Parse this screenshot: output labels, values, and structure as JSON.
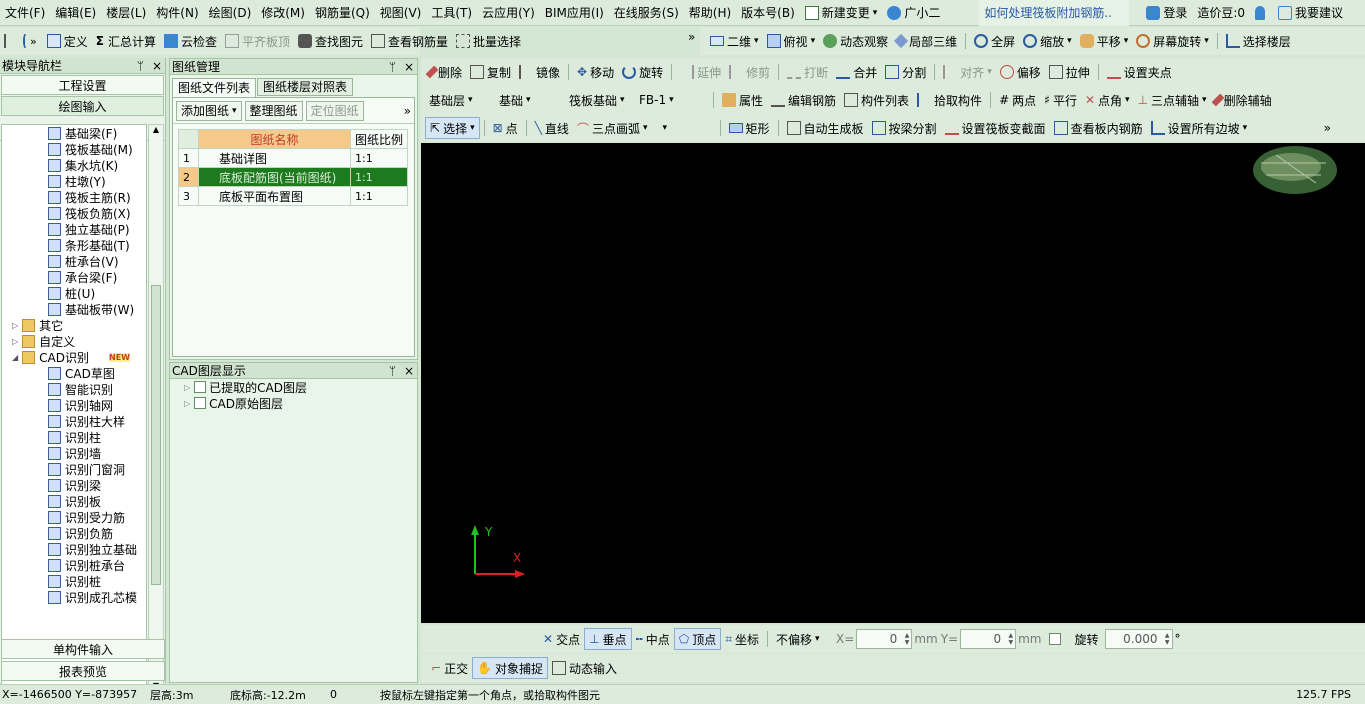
{
  "menu": [
    "文件(F)",
    "编辑(E)",
    "楼层(L)",
    "构件(N)",
    "绘图(D)",
    "修改(M)",
    "钢筋量(Q)",
    "视图(V)",
    "工具(T)",
    "云应用(Y)",
    "BIM应用(I)",
    "在线服务(S)",
    "帮助(H)",
    "版本号(B)"
  ],
  "menu_extra": {
    "new_change": "新建变更",
    "assistant": "广小二",
    "search_prompt": "如何处理筏板附加钢筋..",
    "login": "登录",
    "price_bean": "造价豆:0",
    "suggest": "我要建议"
  },
  "toolbar1": [
    "定义",
    "汇总计算",
    "云检查",
    "平齐板顶",
    "查找图元",
    "查看钢筋量",
    "批量选择"
  ],
  "toolbar1r": [
    "二维",
    "俯视",
    "动态观察",
    "局部三维",
    "全屏",
    "缩放",
    "平移",
    "屏幕旋转",
    "选择楼层"
  ],
  "edit_toolbar": [
    "删除",
    "复制",
    "镜像",
    "移动",
    "旋转",
    "延伸",
    "修剪",
    "打断",
    "合并",
    "分割",
    "对齐",
    "偏移",
    "拉伸",
    "设置夹点"
  ],
  "layer_bar": {
    "floor": "基础层",
    "type": "基础",
    "component": "筏板基础",
    "name": "FB-1",
    "items": [
      "属性",
      "编辑钢筋",
      "构件列表",
      "拾取构件",
      "两点",
      "平行",
      "点角",
      "三点辅轴",
      "删除辅轴"
    ]
  },
  "draw_bar": [
    "选择",
    "点",
    "直线",
    "三点画弧",
    "矩形",
    "自动生成板",
    "按梁分割",
    "设置筏板变截面",
    "查看板内钢筋",
    "设置所有边坡"
  ],
  "nav": {
    "title": "模块导航栏",
    "btn1": "工程设置",
    "btn2": "绘图输入",
    "bottom1": "单构件输入",
    "bottom2": "报表预览",
    "items": [
      "基础梁(F)",
      "筏板基础(M)",
      "集水坑(K)",
      "柱墩(Y)",
      "筏板主筋(R)",
      "筏板负筋(X)",
      "独立基础(P)",
      "条形基础(T)",
      "桩承台(V)",
      "承台梁(F)",
      "桩(U)",
      "基础板带(W)"
    ],
    "folders": [
      "其它",
      "自定义",
      "CAD识别"
    ],
    "new_badge": "NEW",
    "cad_items": [
      "CAD草图",
      "智能识别",
      "识别轴网",
      "识别柱大样",
      "识别柱",
      "识别墙",
      "识别门窗洞",
      "识别梁",
      "识别板",
      "识别受力筋",
      "识别负筋",
      "识别独立基础",
      "识别桩承台",
      "识别桩",
      "识别成孔芯模"
    ]
  },
  "drawing_panel": {
    "title": "图纸管理",
    "tab1": "图纸文件列表",
    "tab2": "图纸楼层对照表",
    "btn_add": "添加图纸",
    "btn_arrange": "整理图纸",
    "btn_locate": "定位图纸",
    "col_name": "图纸名称",
    "col_scale": "图纸比例",
    "rows": [
      {
        "no": "1",
        "name": "基础详图",
        "scale": "1:1"
      },
      {
        "no": "2",
        "name": "底板配筋图(当前图纸)",
        "scale": "1:1"
      },
      {
        "no": "3",
        "name": "底板平面布置图",
        "scale": "1:1"
      }
    ]
  },
  "cad_panel": {
    "title": "CAD图层显示",
    "layer1": "已提取的CAD图层",
    "layer2": "CAD原始图层"
  },
  "snap_bar": {
    "items": [
      "交点",
      "垂点",
      "中点",
      "顶点",
      "坐标"
    ],
    "offset": "不偏移",
    "x_label": "X=",
    "x_val": "0",
    "y_label": "Y=",
    "y_val": "0",
    "unit": "mm",
    "rotate": "旋转",
    "rotate_val": "0.000",
    "deg": "°"
  },
  "mode_bar": [
    "正交",
    "对象捕捉",
    "动态输入"
  ],
  "status": {
    "coords": "X=-1466500 Y=-873957",
    "floor_h": "层高:3m",
    "base_h": "底标高:-12.2m",
    "zero": "0",
    "hint": "按鼠标左键指定第一个角点，或拾取构件图元",
    "fps": "125.7 FPS"
  },
  "axis": {
    "y": "Y",
    "x": "X"
  }
}
